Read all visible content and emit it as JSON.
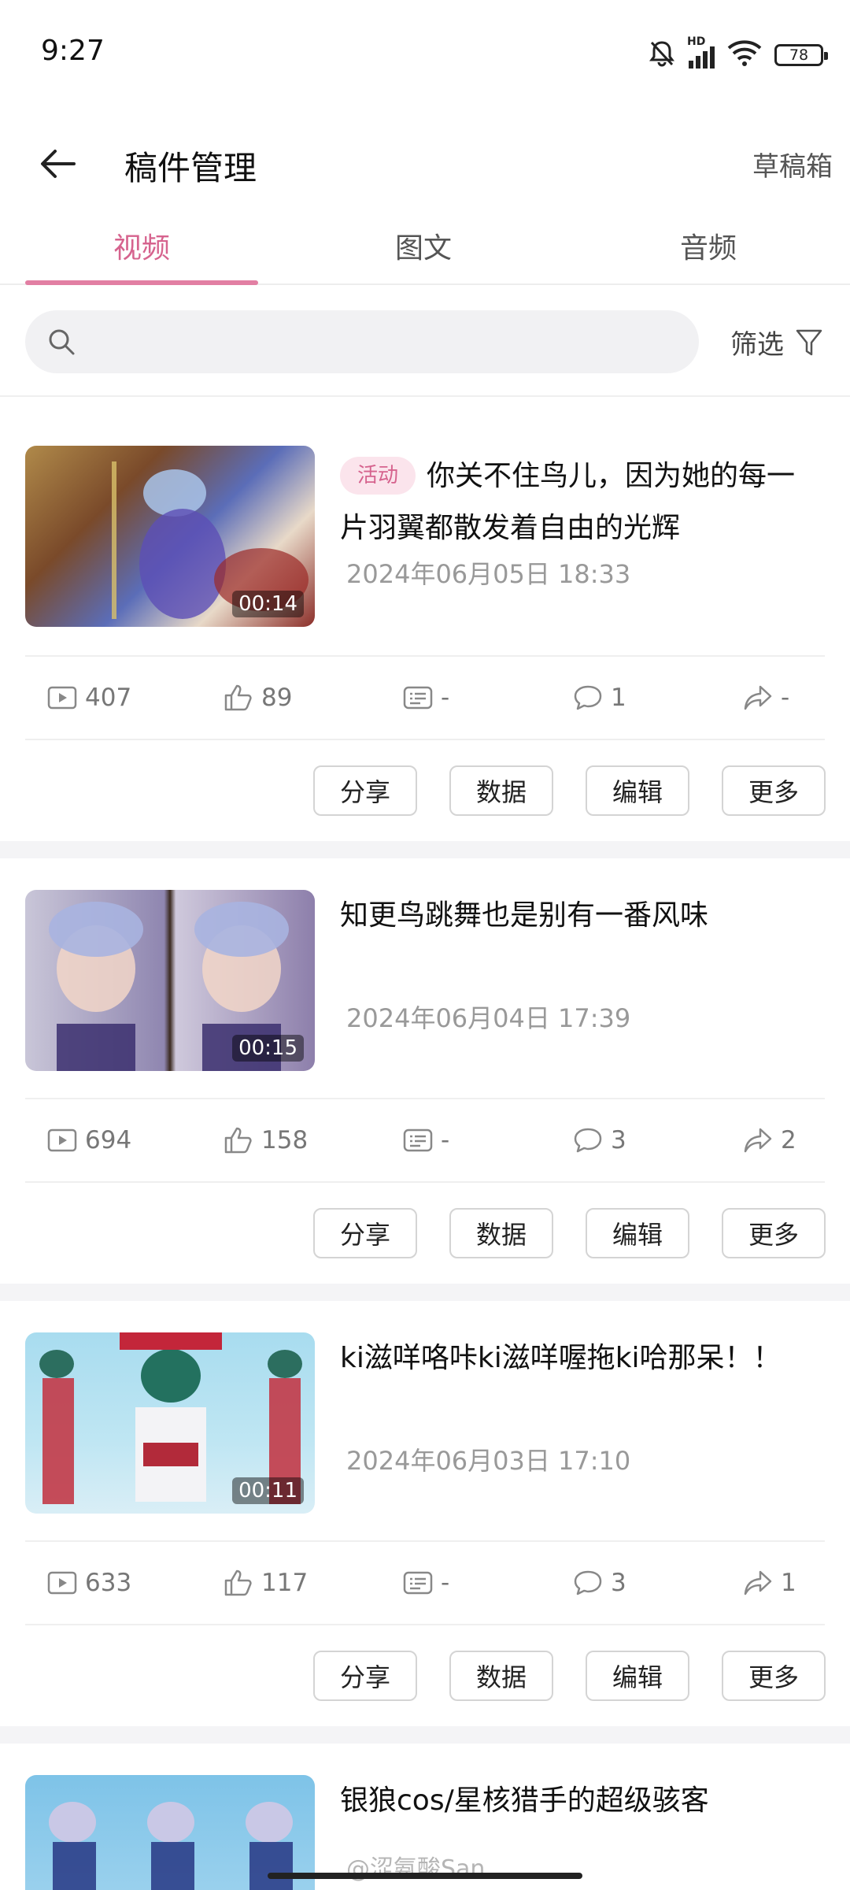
{
  "status_bar": {
    "time": "9:27",
    "network": "HD",
    "battery": "78"
  },
  "header": {
    "title": "稿件管理",
    "drafts_label": "草稿箱"
  },
  "tabs": [
    {
      "label": "视频",
      "active": true
    },
    {
      "label": "图文",
      "active": false
    },
    {
      "label": "音频",
      "active": false
    }
  ],
  "search": {
    "placeholder": "",
    "filter_label": "筛选"
  },
  "colors": {
    "accent": "#d6638e",
    "accent_light": "#fbe4ec",
    "divider": "#efefef"
  },
  "action_labels": {
    "share": "分享",
    "data": "数据",
    "edit": "编辑",
    "more": "更多"
  },
  "videos": [
    {
      "tag": "活动",
      "title": "你关不住鸟儿，因为她的每一片羽翼都散发着自由的光辉",
      "duration": "00:14",
      "date": "2024年06月05日 18:33",
      "plays": "407",
      "likes": "89",
      "danmaku": "-",
      "comments": "1",
      "shares": "-"
    },
    {
      "tag": "",
      "title": "知更鸟跳舞也是别有一番风味",
      "duration": "00:15",
      "date": "2024年06月04日 17:39",
      "plays": "694",
      "likes": "158",
      "danmaku": "-",
      "comments": "3",
      "shares": "2"
    },
    {
      "tag": "",
      "title": "ki滋咩咯咔ki滋咩喔拖ki哈那呆！！",
      "duration": "00:11",
      "date": "2024年06月03日 17:10",
      "plays": "633",
      "likes": "117",
      "danmaku": "-",
      "comments": "3",
      "shares": "1"
    },
    {
      "tag": "",
      "title": "银狼cos/星核猎手的超级骇客",
      "duration": "",
      "date": "",
      "plays": "",
      "likes": "",
      "danmaku": "",
      "comments": "",
      "shares": ""
    }
  ],
  "watermark": "@涩氨酸San"
}
